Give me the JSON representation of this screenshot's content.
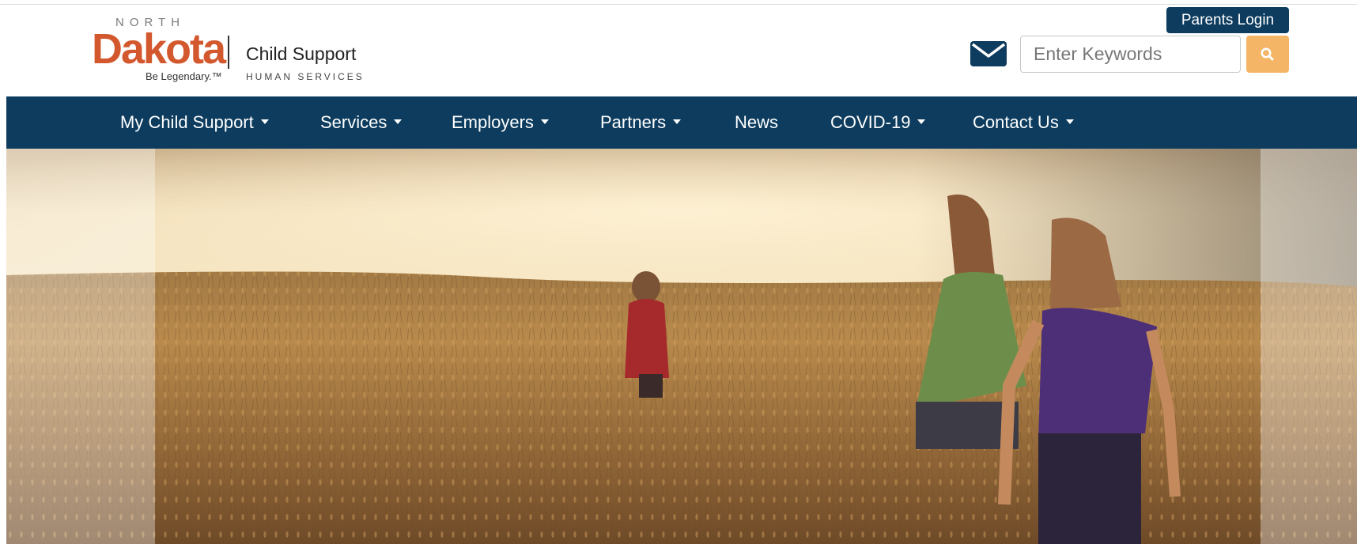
{
  "logo": {
    "north": "NORTH",
    "dakota": "Dakota",
    "tagline": "Be Legendary.™",
    "program": "Child Support",
    "agency": "HUMAN SERVICES"
  },
  "header": {
    "parents_login_label": "Parents Login",
    "search_placeholder": "Enter Keywords",
    "mail_icon": "envelope-icon",
    "search_icon": "magnifier-icon"
  },
  "nav": {
    "items": [
      {
        "label": "My Child Support",
        "has_dropdown": true
      },
      {
        "label": "Services",
        "has_dropdown": true
      },
      {
        "label": "Employers",
        "has_dropdown": true
      },
      {
        "label": "Partners",
        "has_dropdown": true
      },
      {
        "label": "News",
        "has_dropdown": false
      },
      {
        "label": "COVID-19",
        "has_dropdown": true
      },
      {
        "label": "Contact Us",
        "has_dropdown": true
      }
    ]
  },
  "colors": {
    "brand_navy": "#0d3c5e",
    "brand_orange": "#d3582e",
    "search_button": "#f5b567"
  }
}
